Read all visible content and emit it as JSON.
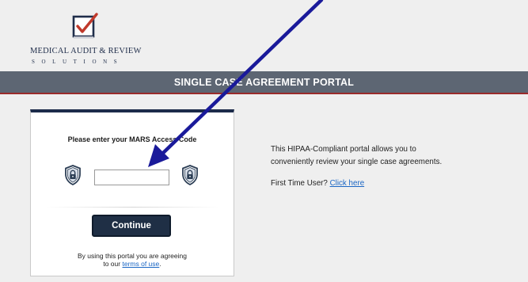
{
  "logo": {
    "line1": "MEDICAL AUDIT & REVIEW",
    "line2": "SOLUTIONS",
    "icon": "checkbox-check-icon",
    "colors": {
      "navy": "#1f2d4a",
      "red": "#c0392b"
    }
  },
  "banner": {
    "title": "SINGLE CASE AGREEMENT PORTAL",
    "background": "#5d6673",
    "accent": "#9a2b2b"
  },
  "login_card": {
    "prompt": "Please enter your MARS Access Code",
    "access_code_value": "",
    "left_icon": "shield-lock-icon",
    "right_icon": "shield-lock-icon",
    "continue_label": "Continue",
    "terms_prefix": "By using this portal you are agreeing",
    "terms_middle": "to our",
    "terms_link": "terms of use",
    "terms_suffix": ".",
    "button_color": "#1f2f45"
  },
  "info": {
    "description_line1": "This HIPAA-Compliant portal allows you to",
    "description_line2": "conveniently review your single case agreements.",
    "first_time_label": "First Time User?",
    "click_here": "Click here"
  },
  "annotation": {
    "arrow_color": "#1a1a9a",
    "icon": "arrow-pointer-icon"
  }
}
